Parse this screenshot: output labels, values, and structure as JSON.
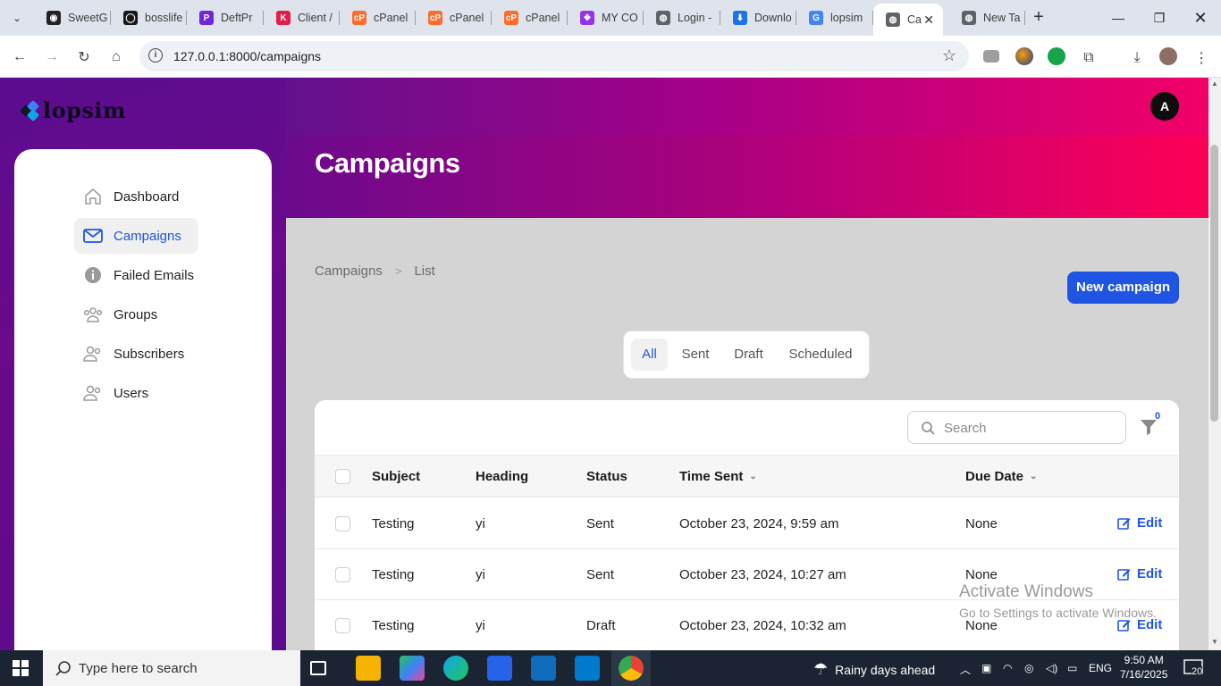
{
  "browser": {
    "tabs": [
      {
        "title": "SweetG",
        "color": "#222222",
        "glyph": "◉"
      },
      {
        "title": "bosslife",
        "color": "#181717",
        "glyph": "◯"
      },
      {
        "title": "DeftPr",
        "color": "#6d28d9",
        "glyph": "P"
      },
      {
        "title": "Client /",
        "color": "#e11d48",
        "glyph": "K"
      },
      {
        "title": "cPanel",
        "color": "#ff6c2c",
        "glyph": "cP"
      },
      {
        "title": "cPanel",
        "color": "#ff6c2c",
        "glyph": "cP"
      },
      {
        "title": "cPanel",
        "color": "#ff6c2c",
        "glyph": "cP"
      },
      {
        "title": "MY CO",
        "color": "#9333ea",
        "glyph": "❖"
      },
      {
        "title": "Login -",
        "color": "#5f6368",
        "glyph": "◍"
      },
      {
        "title": "Downlo",
        "color": "#1a73e8",
        "glyph": "⬇"
      },
      {
        "title": "lopsim",
        "color": "#4285f4",
        "glyph": "G"
      },
      {
        "title": "Ca",
        "color": "#5f6368",
        "glyph": "◍"
      },
      {
        "title": "New Ta",
        "color": "#5f6368",
        "glyph": "◍"
      }
    ],
    "active_tab_index": 11,
    "url": "127.0.0.1:8000/campaigns"
  },
  "app": {
    "logo_text": "lopsim",
    "avatar_letter": "A",
    "page_title": "Campaigns",
    "nav": [
      {
        "label": "Dashboard",
        "icon": "home-icon",
        "active": false
      },
      {
        "label": "Campaigns",
        "icon": "mail-icon",
        "active": true
      },
      {
        "label": "Failed Emails",
        "icon": "info-icon",
        "active": false
      },
      {
        "label": "Groups",
        "icon": "users-group-icon",
        "active": false
      },
      {
        "label": "Subscribers",
        "icon": "subscribers-icon",
        "active": false
      },
      {
        "label": "Users",
        "icon": "users-icon",
        "active": false
      }
    ],
    "breadcrumb": [
      "Campaigns",
      "List"
    ],
    "new_button": "New campaign",
    "filter_tabs": [
      "All",
      "Sent",
      "Draft",
      "Scheduled"
    ],
    "active_filter": "All",
    "search_placeholder": "Search",
    "filter_count": "0",
    "columns": [
      "Subject",
      "Heading",
      "Status",
      "Time Sent",
      "Due Date"
    ],
    "rows": [
      {
        "subject": "Testing",
        "heading": "yi",
        "status": "Sent",
        "time_sent": "October 23, 2024, 9:59 am",
        "due_date": "None",
        "action": "Edit"
      },
      {
        "subject": "Testing",
        "heading": "yi",
        "status": "Sent",
        "time_sent": "October 23, 2024, 10:27 am",
        "due_date": "None",
        "action": "Edit"
      },
      {
        "subject": "Testing",
        "heading": "yi",
        "status": "Draft",
        "time_sent": "October 23, 2024, 10:32 am",
        "due_date": "None",
        "action": "Edit"
      }
    ]
  },
  "watermark": {
    "line1": "Activate Windows",
    "line2": "Go to Settings to activate Windows."
  },
  "taskbar": {
    "search_placeholder": "Type here to search",
    "weather": "Rainy days ahead",
    "language": "ENG",
    "time": "9:50 AM",
    "date": "7/16/2025",
    "notifications": "20"
  }
}
